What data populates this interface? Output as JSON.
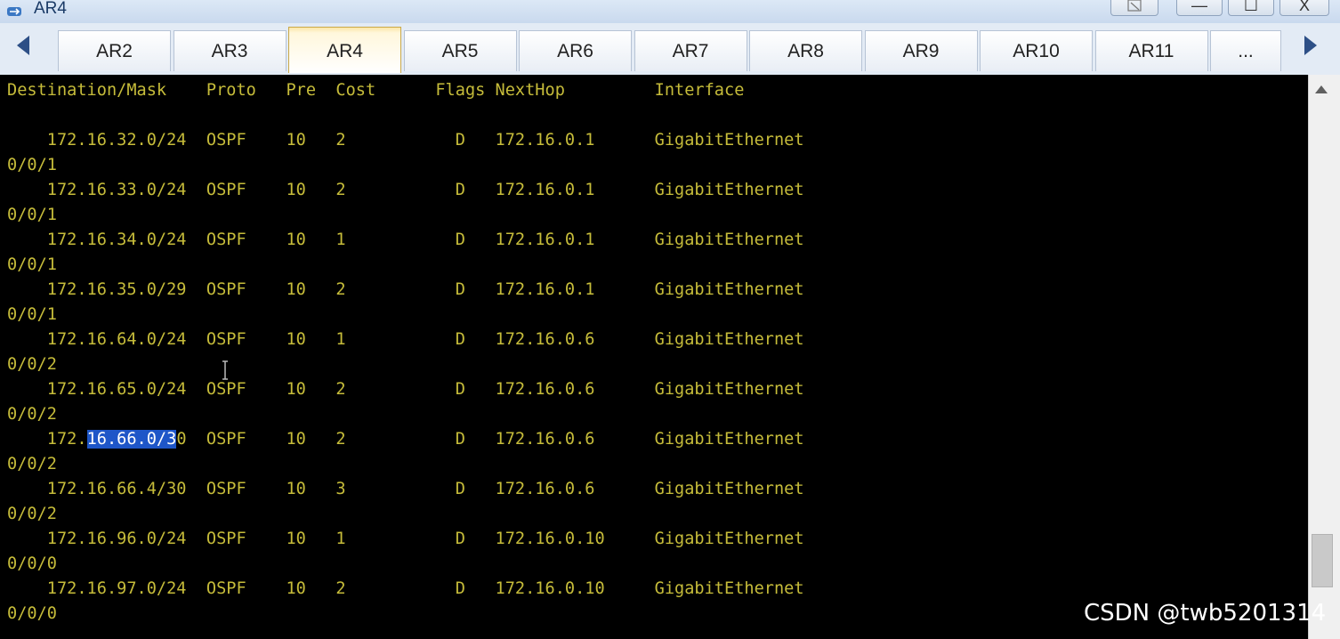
{
  "window": {
    "title": "AR4",
    "minimize_glyph": "—",
    "maximize_glyph": "☐",
    "close_glyph": "X"
  },
  "tabs": [
    {
      "label": "AR2"
    },
    {
      "label": "AR3"
    },
    {
      "label": "AR4",
      "active": true
    },
    {
      "label": "AR5"
    },
    {
      "label": "AR6"
    },
    {
      "label": "AR7"
    },
    {
      "label": "AR8"
    },
    {
      "label": "AR9"
    },
    {
      "label": "AR10"
    },
    {
      "label": "AR11"
    },
    {
      "label": "..."
    }
  ],
  "terminal": {
    "header": "Destination/Mask    Proto   Pre  Cost      Flags NextHop         Interface",
    "lines": [
      "",
      "    172.16.32.0/24  OSPF    10   2           D   172.16.0.1      GigabitEthernet",
      "0/0/1",
      "    172.16.33.0/24  OSPF    10   2           D   172.16.0.1      GigabitEthernet",
      "0/0/1",
      "    172.16.34.0/24  OSPF    10   1           D   172.16.0.1      GigabitEthernet",
      "0/0/1",
      "    172.16.35.0/29  OSPF    10   2           D   172.16.0.1      GigabitEthernet",
      "0/0/1",
      "    172.16.64.0/24  OSPF    10   1           D   172.16.0.6      GigabitEthernet",
      "0/0/2",
      "    172.16.65.0/24  OSPF    10   2           D   172.16.0.6      GigabitEthernet",
      "0/0/2"
    ],
    "selected_line": {
      "before": "    172.",
      "selection": "16.66.0/3",
      "after": "0  OSPF    10   2           D   172.16.0.6      GigabitEthernet"
    },
    "lines_after": [
      "0/0/2",
      "    172.16.66.4/30  OSPF    10   3           D   172.16.0.6      GigabitEthernet",
      "0/0/2",
      "    172.16.96.0/24  OSPF    10   1           D   172.16.0.10     GigabitEthernet",
      "0/0/0",
      "    172.16.97.0/24  OSPF    10   2           D   172.16.0.10     GigabitEthernet",
      "0/0/0"
    ]
  },
  "watermark": "CSDN @twb5201314",
  "colors": {
    "terminal_bg": "#000000",
    "terminal_text": "#c6bc3a",
    "selection": "#1e56c8",
    "tab_active_top": "#fbe6a6"
  }
}
